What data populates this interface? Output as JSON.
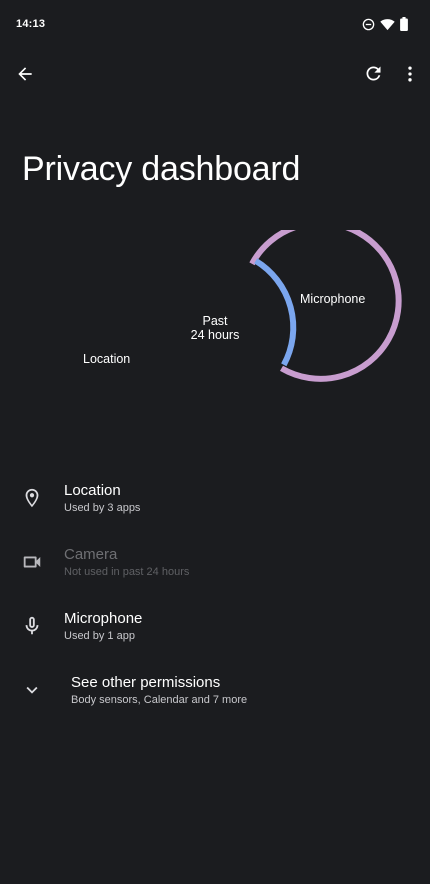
{
  "status_bar": {
    "time": "14:13",
    "icons": [
      "do-not-disturb-icon",
      "wifi-icon",
      "battery-icon"
    ]
  },
  "top_bar": {
    "back_icon": "arrow-back-icon",
    "refresh_icon": "refresh-icon",
    "more_icon": "more-vert-icon"
  },
  "page": {
    "title": "Privacy dashboard"
  },
  "donut": {
    "center_line1": "Past",
    "center_line2": "24 hours",
    "microphone_label": "Microphone",
    "location_label": "Location",
    "colors": {
      "location": "#c89dcf",
      "microphone": "#7ba6ee"
    }
  },
  "permissions": [
    {
      "title": "Location",
      "subtitle": "Used by 3 apps",
      "icon": "location-pin-icon",
      "enabled": true
    },
    {
      "title": "Camera",
      "subtitle": "Not used in past 24 hours",
      "icon": "videocam-icon",
      "enabled": false
    },
    {
      "title": "Microphone",
      "subtitle": "Used by 1 app",
      "icon": "mic-icon",
      "enabled": true
    },
    {
      "title": "See other permissions",
      "subtitle": "Body sensors, Calendar and 7 more",
      "icon": "chevron-down-icon",
      "enabled": true
    }
  ]
}
